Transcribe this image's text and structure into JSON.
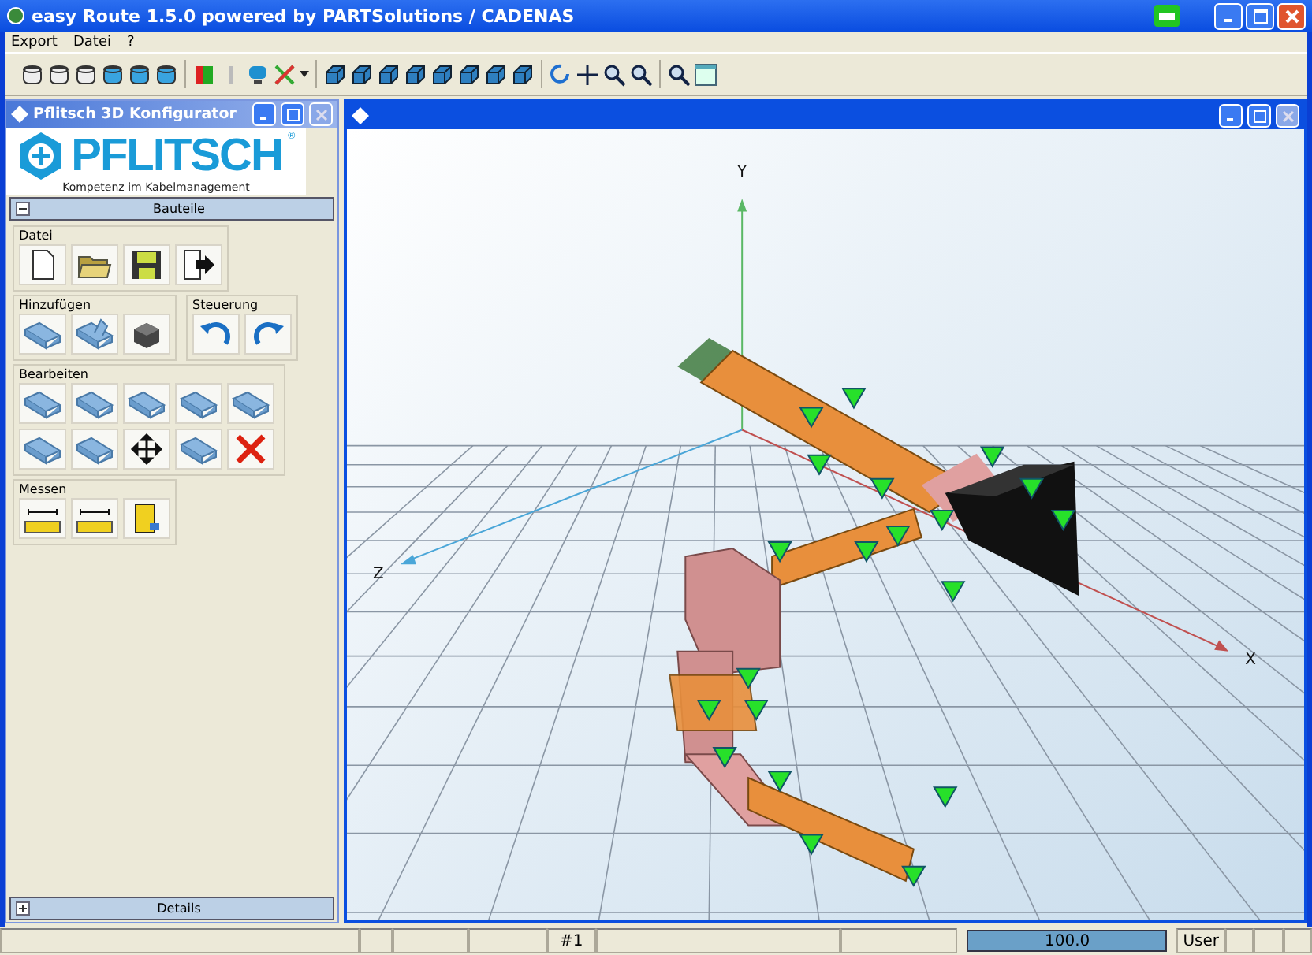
{
  "window": {
    "title": "easy Route 1.5.0 powered by PARTSolutions / CADENAS"
  },
  "menu": [
    "Export",
    "Datei",
    "?"
  ],
  "panel": {
    "title": "Pflitsch 3D Konfigurator",
    "logo": "PFLITSCH",
    "logo_mark": "®",
    "tagline": "Kompetenz im Kabelmanagement",
    "sections": [
      {
        "label": "Bauteile",
        "expanded": true
      },
      {
        "label": "Details",
        "expanded": false
      }
    ],
    "groups": [
      {
        "title": "Datei"
      },
      {
        "title": "Hinzufügen"
      },
      {
        "title": "Steuerung"
      },
      {
        "title": "Bearbeiten"
      },
      {
        "title": "Messen"
      }
    ]
  },
  "viewport": {
    "axes": [
      {
        "label": "Y"
      },
      {
        "label": "Z"
      },
      {
        "label": "X"
      }
    ]
  },
  "status_bar": {
    "cells": [
      {
        "text": ""
      },
      {
        "text": ""
      },
      {
        "text": "#1"
      },
      {
        "text": ""
      },
      {
        "text": ""
      }
    ],
    "progress": {
      "level": 1,
      "reading": "100.0"
    },
    "user": "User"
  }
}
